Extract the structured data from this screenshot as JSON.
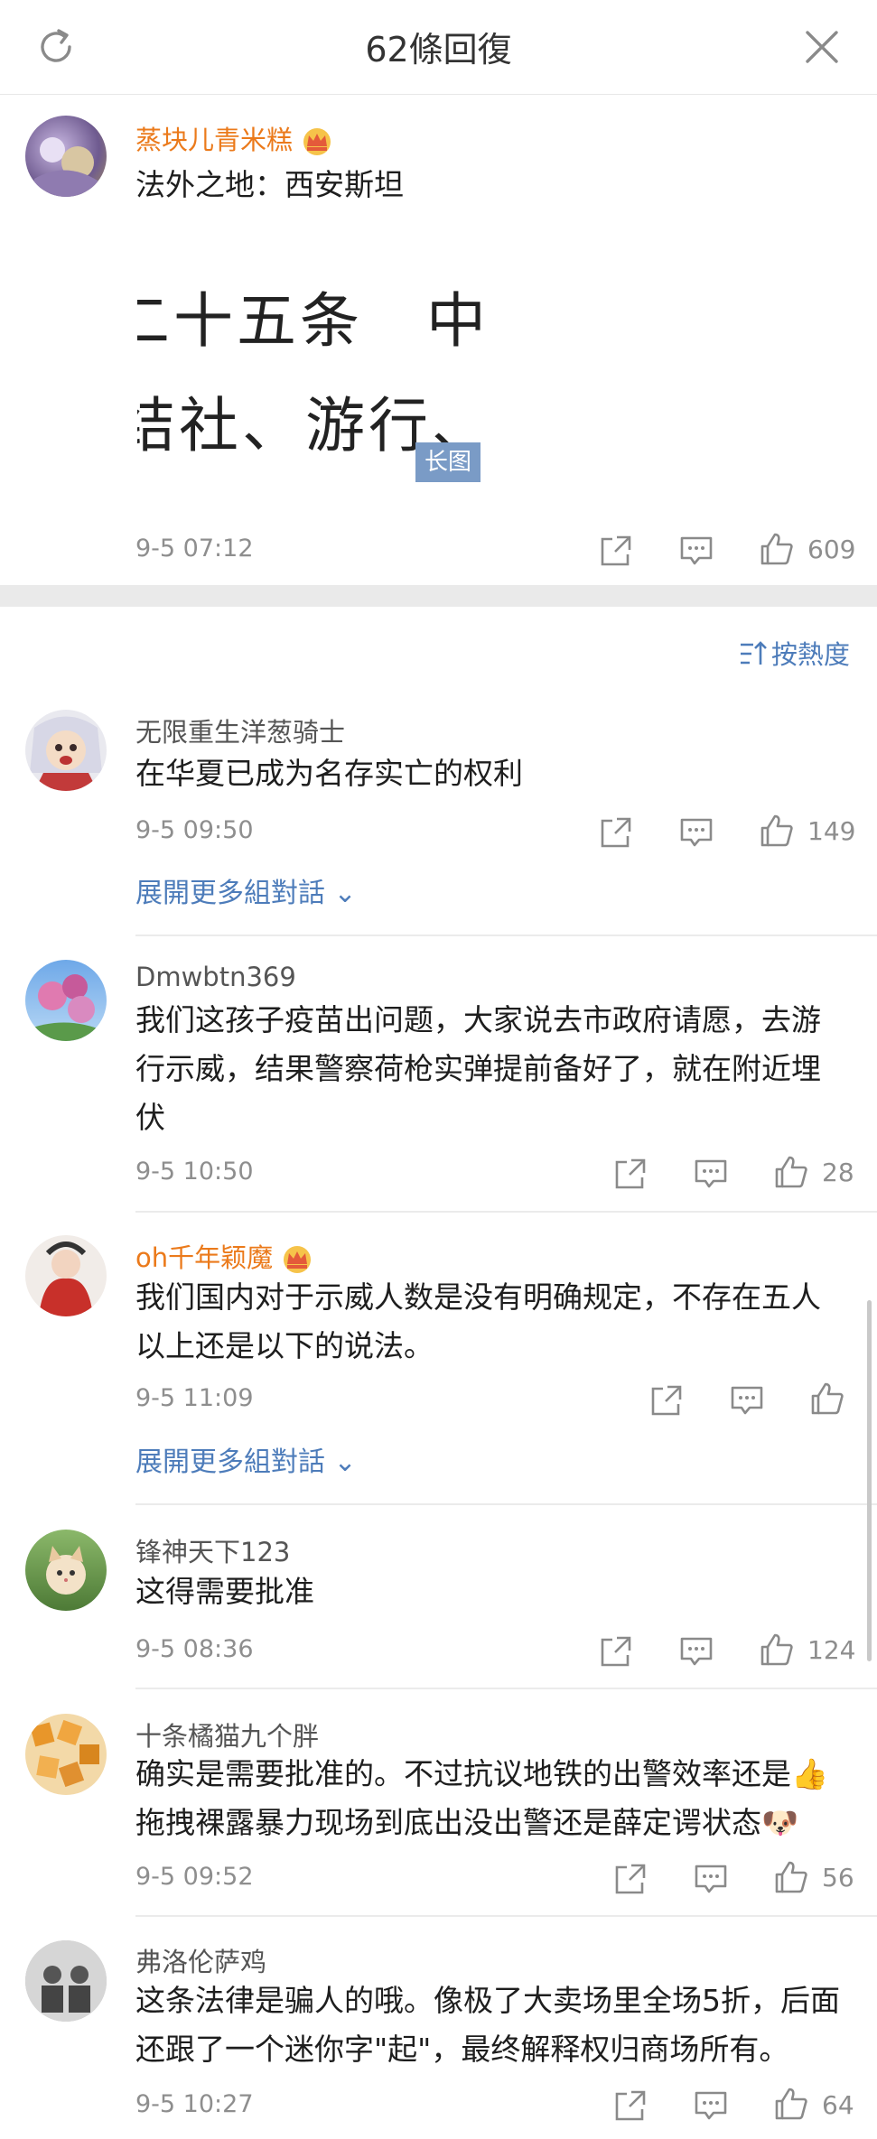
{
  "header": {
    "title": "62條回復"
  },
  "op": {
    "name": "蒸块儿青米糕",
    "text": "法外之地：西安斯坦",
    "image_line1": "二十五条　中华人",
    "image_line2": "结社、游行、示威",
    "image_badge": "长图",
    "time": "9-5 07:12",
    "likes": "609"
  },
  "sort_label": "按熱度",
  "comments": [
    {
      "name": "无限重生洋葱骑士",
      "lines": [
        "在华夏已成为名存实亡的权利"
      ],
      "time": "9-5 09:50",
      "likes": "149",
      "expand": "展開更多組對話"
    },
    {
      "name": "Dmwbtn369",
      "lines": [
        "我们这孩子疫苗出问题，大家说去市政府请愿，去游",
        "行示威，结果警察荷枪实弹提前备好了，就在附近埋",
        "伏"
      ],
      "time": "9-5 10:50",
      "likes": "28"
    },
    {
      "name": "oh千年颖魔",
      "lines": [
        "我们国内对于示威人数是没有明确规定，不存在五人",
        "以上还是以下的说法。"
      ],
      "time": "9-5 11:09",
      "likes": "",
      "expand": "展開更多組對話"
    },
    {
      "name": "锋神天下123",
      "lines": [
        "这得需要批准"
      ],
      "time": "9-5 08:36",
      "likes": "124"
    },
    {
      "name": "十条橘猫九个胖",
      "lines": [
        "确实是需要批准的。不过抗议地铁的出警效率还是👍",
        "拖拽裸露暴力现场到底出没出警还是薛定谔状态🐶"
      ],
      "time": "9-5 09:52",
      "likes": "56"
    },
    {
      "name": "弗洛伦萨鸡",
      "lines": [
        "这条法律是骗人的哦。像极了大卖场里全场5折，后面",
        "还跟了一个迷你字\"起\"，最终解释权归商场所有。"
      ],
      "time": "9-5 10:27",
      "likes": "64"
    }
  ],
  "colors": {
    "vip_name": "#eb7a1b",
    "link": "#4d7cba",
    "muted": "#8e8e8e"
  },
  "icons": [
    "refresh-icon",
    "close-icon",
    "crown-icon",
    "share-icon",
    "comment-icon",
    "like-icon",
    "sort-icon"
  ]
}
